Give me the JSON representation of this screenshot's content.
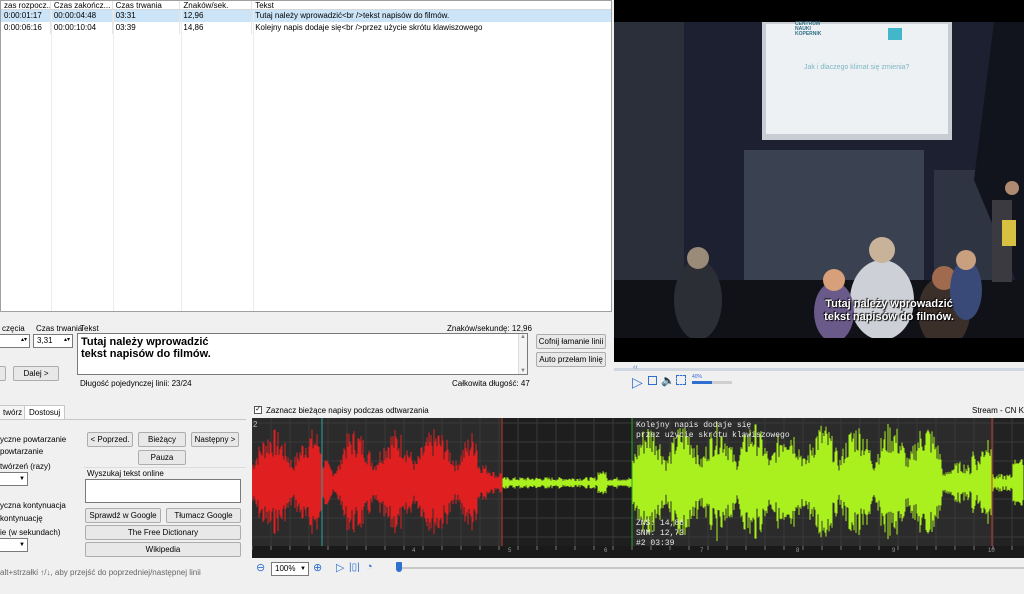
{
  "grid": {
    "headers": [
      "zas rozpocz...",
      "Czas zakończ...",
      "Czas trwania",
      "Znaków/sek.",
      "Tekst"
    ],
    "rows": [
      {
        "start": "0:00:01:17",
        "end": "00:00:04:48",
        "duration": "03:31",
        "cps": "12,96",
        "text": "Tutaj należy wprowadzić<br />tekst napisów do filmów.",
        "selected": true
      },
      {
        "start": "0:00:06:16",
        "end": "00:00:10:04",
        "duration": "03:39",
        "cps": "14,86",
        "text": "Kolejny napis dodaje się<br />przez użycie skrótu klawiszowego",
        "selected": false
      }
    ]
  },
  "editor": {
    "start_label": "częcia",
    "duration_label": "Czas trwania",
    "text_label": "Tekst",
    "cps_label": "Znaków/sekundę: 12,96",
    "duration_value": "3,31",
    "subtitle_text": "Tutaj należy wprowadzić\ntekst napisów do filmów.",
    "undo_linebreak": "Cofnij łamanie linii",
    "auto_linebreak": "Auto przełam linię",
    "next_button": "Dalej >",
    "line_length": "Długość pojedynczej linii: 23/24",
    "total_length": "Całkowita długość: 47"
  },
  "video": {
    "subtitle_line1": "Tutaj należy wprowadzić",
    "subtitle_line2": "tekst napisów do filmów.",
    "slide_title": "Jak i dlaczego klimat się zmienia?",
    "slide_logo": "CENTRUM NAUKI KOPERNIK",
    "volume_label": "40%"
  },
  "tools": {
    "tab_create": "twórz",
    "tab_adjust": "Dostosuj",
    "loop_label": "yczne powtarzanie",
    "loop_check": "powtarzanie",
    "loop_count_label": "twórzeń (razy)",
    "continue_label": "yczna kontynuacja",
    "continue_check": "kontynuację",
    "continue_delay": "ie (w sekundach)",
    "prev_button": "< Poprzed.",
    "current_button": "Bieżący",
    "next_button": "Następny >",
    "pause_button": "Pauza",
    "search_label": "Wyszukaj tekst online",
    "google_search": "Sprawdź w Google",
    "google_translate": "Tłumacz Google",
    "free_dictionary": "The Free Dictionary",
    "wikipedia": "Wikipedia",
    "hint": "alt+strzałki ↑/↓, aby przejść do poprzedniej/następnej linii"
  },
  "waveform": {
    "sync_label": "Zaznacz bieżące napisy podczas odtwarzania",
    "stream_label": "Stream - CN Ko",
    "overlay_line1": "Kolejny napis dodaje się",
    "overlay_line2": "przez użycie skrótu klawiszowego",
    "info_zns": "ZNS: 14,86",
    "info_snm": "SNM: 12,73",
    "info_index": "#2 03:39",
    "zoom_value": "100%",
    "ticks": [
      "4",
      "5",
      "6",
      "7",
      "8",
      "9",
      "10"
    ],
    "left_marker": "2",
    "colors": {
      "segment1": "#e02020",
      "segment2": "#aaf01e",
      "gap": "#aaf01e",
      "bg": "#222222"
    }
  }
}
